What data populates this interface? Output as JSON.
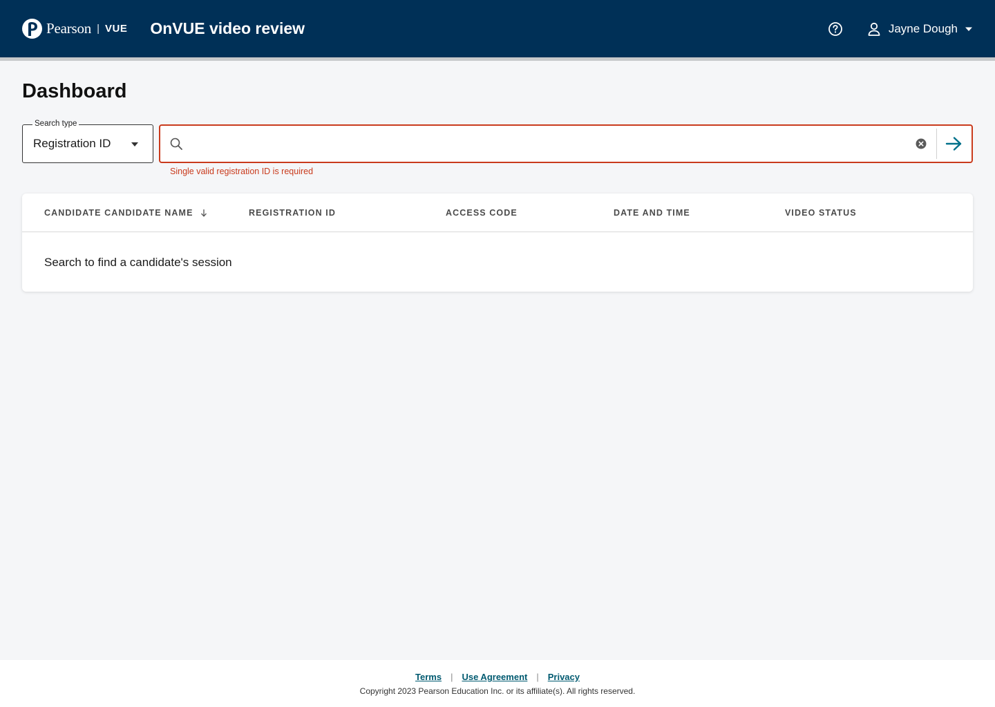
{
  "header": {
    "logo_brand": "Pearson",
    "logo_separator": "|",
    "logo_product": "VUE",
    "app_title": "OnVUE video review",
    "user_name": "Jayne Dough",
    "icons": [
      "help-icon",
      "user-icon",
      "caret-down-icon"
    ],
    "background_color": "#003057"
  },
  "page": {
    "title": "Dashboard"
  },
  "search": {
    "type_legend": "Search type",
    "type_value": "Registration ID",
    "input_value": "",
    "input_placeholder": "",
    "error_message": "Single valid registration ID is required",
    "error_color": "#c93a1c",
    "submit_icon": "arrow-right-icon"
  },
  "table": {
    "columns": [
      {
        "label": "CANDIDATE CANDIDATE NAME",
        "sortable": true
      },
      {
        "label": "REGISTRATION ID"
      },
      {
        "label": "ACCESS CODE"
      },
      {
        "label": "DATE AND TIME"
      },
      {
        "label": "VIDEO STATUS"
      }
    ],
    "empty_message": "Search to find a candidate's session"
  },
  "footer": {
    "links": [
      "Terms",
      "Use Agreement",
      "Privacy"
    ],
    "separator": "|",
    "copyright": "Copyright 2023 Pearson Education Inc. or its affiliate(s). All rights reserved."
  }
}
